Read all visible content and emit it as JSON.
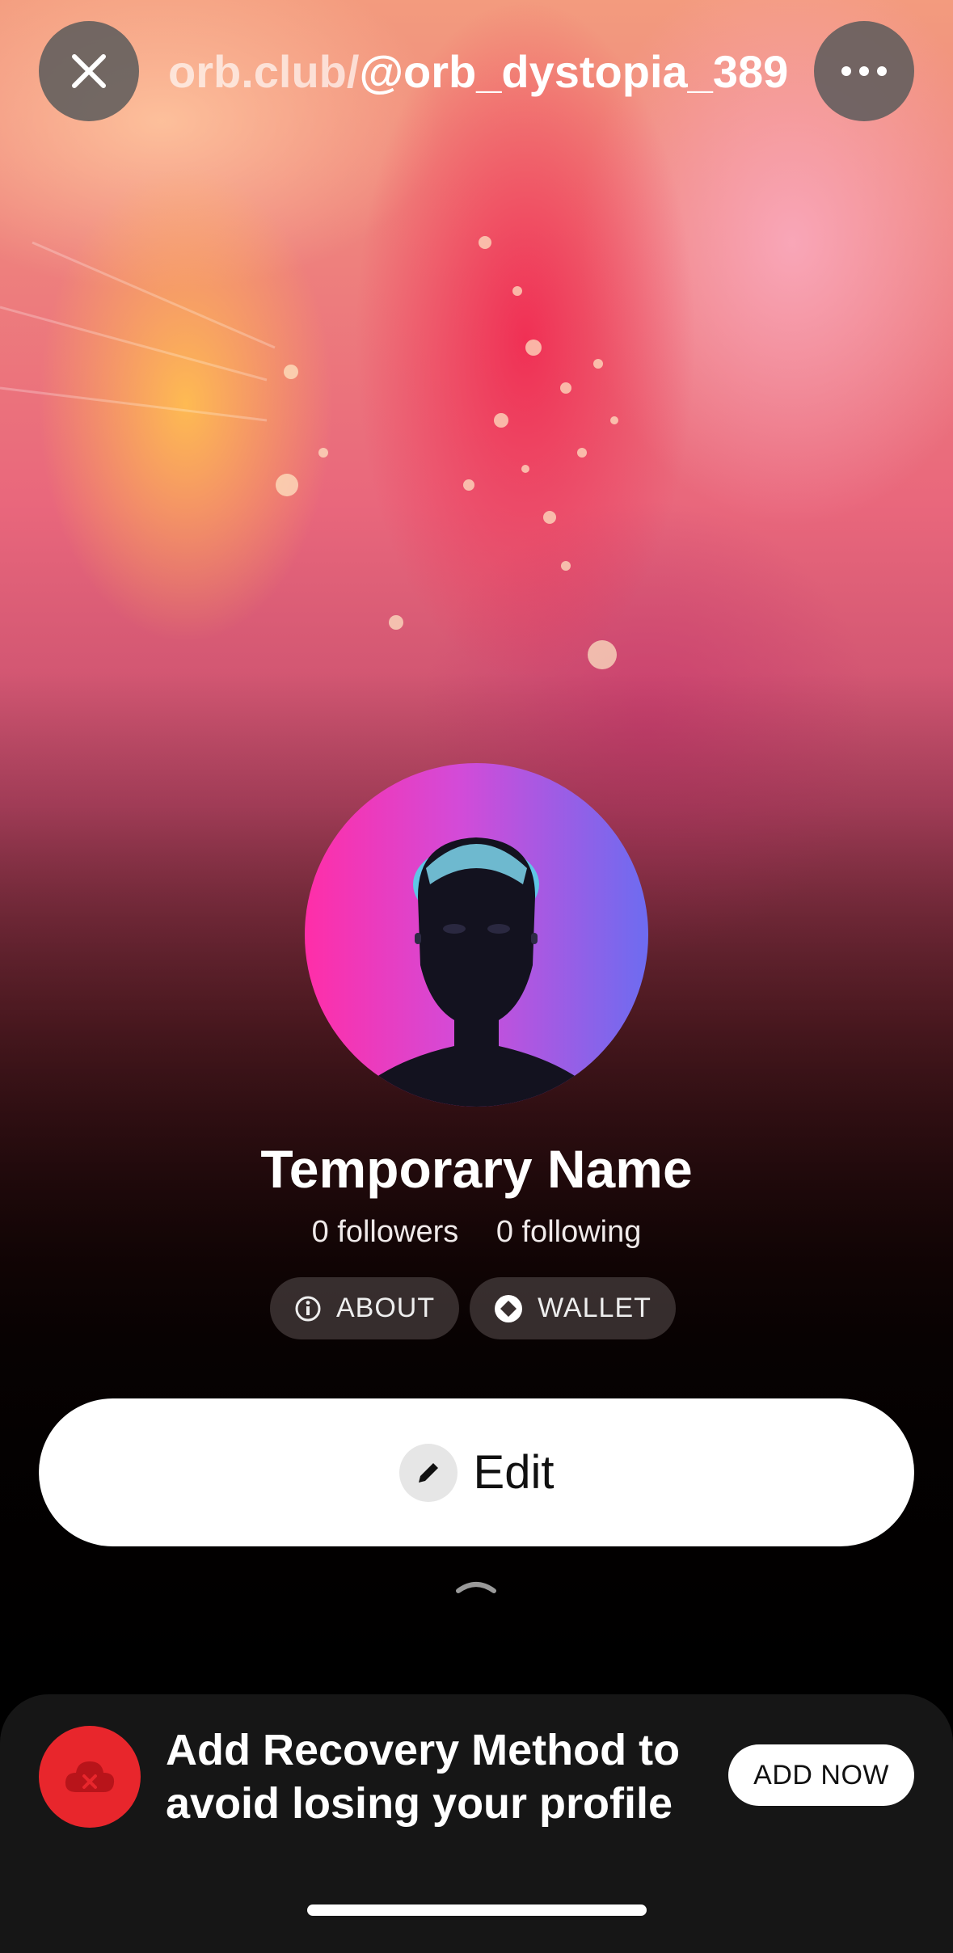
{
  "topbar": {
    "url_domain": "orb.club/",
    "url_handle": "@orb_dystopia_389",
    "close_icon": "close-icon",
    "more_icon": "more-horizontal-icon"
  },
  "profile": {
    "name": "Temporary Name",
    "followers": "0 followers",
    "following": "0 following",
    "about_label": "ABOUT",
    "wallet_label": "WALLET",
    "edit_label": "Edit"
  },
  "banner": {
    "text_line1": "Add Recovery Method to",
    "text_line2": "avoid losing your profile",
    "button_label": "ADD NOW"
  },
  "colors": {
    "accent_red": "#e8262c",
    "button_bg": "#ffffff"
  }
}
